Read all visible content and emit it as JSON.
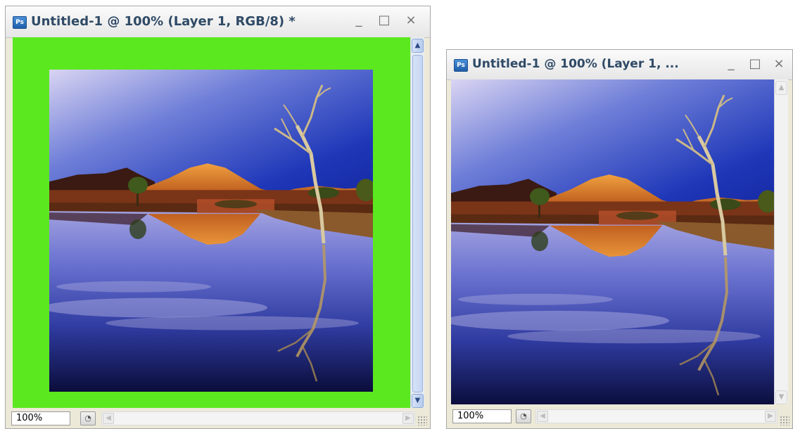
{
  "app_icon": "Ps",
  "windows": [
    {
      "title": "Untitled-1 @ 100% (Layer 1, RGB/8) *",
      "zoom": "100%",
      "canvas_color": "#5be81f",
      "controls": {
        "minimize": "_",
        "maximize": "□",
        "close": "×"
      }
    },
    {
      "title": "Untitled-1 @ 100% (Layer 1, ...",
      "zoom": "100%",
      "controls": {
        "minimize": "_",
        "maximize": "□",
        "close": "×"
      }
    }
  ],
  "icons": {
    "app": "photoshop-icon",
    "scroll_up": "chevron-up-icon",
    "scroll_down": "chevron-down-icon",
    "scroll_left": "chevron-left-icon",
    "scroll_right": "chevron-right-icon",
    "status": "document-status-icon",
    "grip": "resize-grip-icon"
  }
}
